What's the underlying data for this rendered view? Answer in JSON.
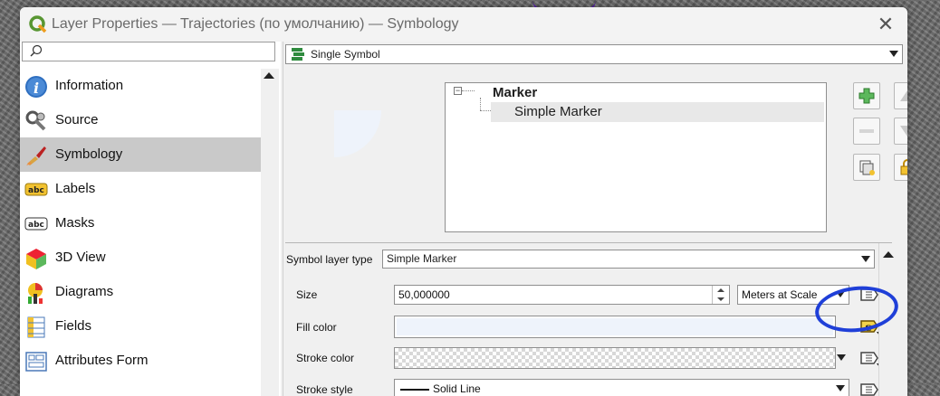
{
  "window": {
    "title": "Layer Properties — Trajectories (по умолчанию) — Symbology",
    "close_glyph": "✕"
  },
  "sidebar": {
    "search_placeholder": "",
    "items": [
      {
        "label": "Information",
        "icon": "information-icon"
      },
      {
        "label": "Source",
        "icon": "source-icon"
      },
      {
        "label": "Symbology",
        "icon": "symbology-icon",
        "active": true
      },
      {
        "label": "Labels",
        "icon": "labels-icon"
      },
      {
        "label": "Masks",
        "icon": "masks-icon"
      },
      {
        "label": "3D View",
        "icon": "3d-view-icon"
      },
      {
        "label": "Diagrams",
        "icon": "diagrams-icon"
      },
      {
        "label": "Fields",
        "icon": "fields-icon"
      },
      {
        "label": "Attributes Form",
        "icon": "attributes-form-icon"
      }
    ]
  },
  "renderer": {
    "selected": "Single Symbol"
  },
  "symbol_tree": {
    "root": "Marker",
    "child": "Simple Marker"
  },
  "symbol_layer": {
    "type_label": "Symbol layer type",
    "type_value": "Simple Marker",
    "size_label": "Size",
    "size_value": "50,000000",
    "size_unit": "Meters at Scale",
    "fill_color_label": "Fill color",
    "fill_color": "#eef3fb",
    "stroke_color_label": "Stroke color",
    "stroke_style_label": "Stroke style",
    "stroke_style_value": "Solid Line"
  },
  "annotation": {
    "color": "#1f3fd8"
  }
}
